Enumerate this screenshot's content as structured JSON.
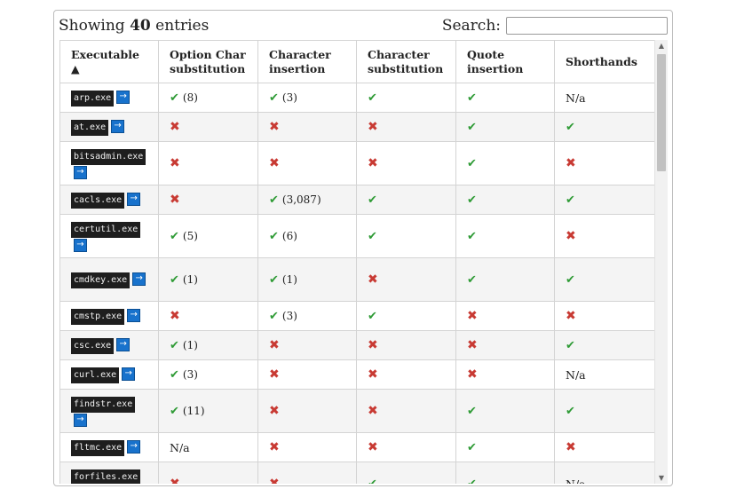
{
  "header": {
    "showing_prefix": "Showing",
    "showing_count": "40",
    "showing_suffix": "entries",
    "search_label": "Search:",
    "search_value": ""
  },
  "columns": [
    "Executable ▲",
    "Option Char substitution",
    "Character insertion",
    "Character substitution",
    "Quote insertion",
    "Shorthands"
  ],
  "link_glyph": "→",
  "rows": [
    {
      "exe": "arp.exe",
      "tall": false,
      "cells": [
        {
          "mark": "check",
          "count": "(8)"
        },
        {
          "mark": "check",
          "count": "(3)"
        },
        {
          "mark": "check"
        },
        {
          "mark": "check"
        },
        {
          "text": "N/a"
        }
      ]
    },
    {
      "exe": "at.exe",
      "tall": false,
      "cells": [
        {
          "mark": "cross"
        },
        {
          "mark": "cross"
        },
        {
          "mark": "cross"
        },
        {
          "mark": "check"
        },
        {
          "mark": "check"
        }
      ]
    },
    {
      "exe": "bitsadmin.exe",
      "tall": true,
      "cells": [
        {
          "mark": "cross"
        },
        {
          "mark": "cross"
        },
        {
          "mark": "cross"
        },
        {
          "mark": "check"
        },
        {
          "mark": "cross"
        }
      ]
    },
    {
      "exe": "cacls.exe",
      "tall": false,
      "cells": [
        {
          "mark": "cross"
        },
        {
          "mark": "check",
          "count": "(3,087)"
        },
        {
          "mark": "check"
        },
        {
          "mark": "check"
        },
        {
          "mark": "check"
        }
      ]
    },
    {
      "exe": "certutil.exe",
      "tall": true,
      "cells": [
        {
          "mark": "check",
          "count": "(5)"
        },
        {
          "mark": "check",
          "count": "(6)"
        },
        {
          "mark": "check"
        },
        {
          "mark": "check"
        },
        {
          "mark": "cross"
        }
      ]
    },
    {
      "exe": "cmdkey.exe",
      "tall": true,
      "cells": [
        {
          "mark": "check",
          "count": "(1)"
        },
        {
          "mark": "check",
          "count": "(1)"
        },
        {
          "mark": "cross"
        },
        {
          "mark": "check"
        },
        {
          "mark": "check"
        }
      ]
    },
    {
      "exe": "cmstp.exe",
      "tall": false,
      "cells": [
        {
          "mark": "cross"
        },
        {
          "mark": "check",
          "count": "(3)"
        },
        {
          "mark": "check"
        },
        {
          "mark": "cross"
        },
        {
          "mark": "cross"
        }
      ]
    },
    {
      "exe": "csc.exe",
      "tall": false,
      "cells": [
        {
          "mark": "check",
          "count": "(1)"
        },
        {
          "mark": "cross"
        },
        {
          "mark": "cross"
        },
        {
          "mark": "cross"
        },
        {
          "mark": "check"
        }
      ]
    },
    {
      "exe": "curl.exe",
      "tall": false,
      "cells": [
        {
          "mark": "check",
          "count": "(3)"
        },
        {
          "mark": "cross"
        },
        {
          "mark": "cross"
        },
        {
          "mark": "cross"
        },
        {
          "text": "N/a"
        }
      ]
    },
    {
      "exe": "findstr.exe",
      "tall": true,
      "cells": [
        {
          "mark": "check",
          "count": "(11)"
        },
        {
          "mark": "cross"
        },
        {
          "mark": "cross"
        },
        {
          "mark": "check"
        },
        {
          "mark": "check"
        }
      ]
    },
    {
      "exe": "fltmc.exe",
      "tall": false,
      "cells": [
        {
          "text": "N/a"
        },
        {
          "mark": "cross"
        },
        {
          "mark": "cross"
        },
        {
          "mark": "check"
        },
        {
          "mark": "cross"
        }
      ]
    },
    {
      "exe": "forfiles.exe",
      "tall": true,
      "cells": [
        {
          "mark": "cross"
        },
        {
          "mark": "cross"
        },
        {
          "mark": "check"
        },
        {
          "mark": "check"
        },
        {
          "text": "N/a"
        }
      ]
    }
  ],
  "icons": {
    "check": "checkmark-icon",
    "cross": "cross-icon",
    "link": "arrow-right-icon"
  },
  "colors": {
    "check": "#2f9b36",
    "cross": "#c83a33",
    "link": "#1872cc",
    "exe_bg": "#1e1e1e"
  }
}
